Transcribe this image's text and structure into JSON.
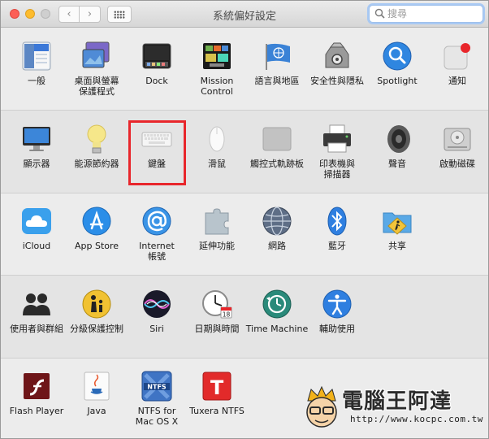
{
  "window": {
    "title": "系統偏好設定",
    "search_placeholder": "搜尋"
  },
  "rows": [
    [
      {
        "label": "一般",
        "icon": "general-icon"
      },
      {
        "label": "桌面與螢幕\n保護程式",
        "icon": "desktop-screensaver-icon"
      },
      {
        "label": "Dock",
        "icon": "dock-icon"
      },
      {
        "label": "Mission\nControl",
        "icon": "mission-control-icon"
      },
      {
        "label": "語言與地區",
        "icon": "language-region-icon"
      },
      {
        "label": "安全性與隱私",
        "icon": "security-privacy-icon"
      },
      {
        "label": "Spotlight",
        "icon": "spotlight-icon"
      },
      {
        "label": "通知",
        "icon": "notifications-icon"
      }
    ],
    [
      {
        "label": "顯示器",
        "icon": "displays-icon"
      },
      {
        "label": "能源節約器",
        "icon": "energy-saver-icon"
      },
      {
        "label": "鍵盤",
        "icon": "keyboard-icon"
      },
      {
        "label": "滑鼠",
        "icon": "mouse-icon"
      },
      {
        "label": "觸控式軌跡板",
        "icon": "trackpad-icon"
      },
      {
        "label": "印表機與\n掃描器",
        "icon": "printers-scanners-icon"
      },
      {
        "label": "聲音",
        "icon": "sound-icon"
      },
      {
        "label": "啟動磁碟",
        "icon": "startup-disk-icon"
      }
    ],
    [
      {
        "label": "iCloud",
        "icon": "icloud-icon"
      },
      {
        "label": "App Store",
        "icon": "app-store-icon"
      },
      {
        "label": "Internet\n帳號",
        "icon": "internet-accounts-icon"
      },
      {
        "label": "延伸功能",
        "icon": "extensions-icon"
      },
      {
        "label": "網路",
        "icon": "network-icon"
      },
      {
        "label": "藍牙",
        "icon": "bluetooth-icon"
      },
      {
        "label": "共享",
        "icon": "sharing-icon"
      }
    ],
    [
      {
        "label": "使用者與群組",
        "icon": "users-groups-icon"
      },
      {
        "label": "分級保護控制",
        "icon": "parental-controls-icon"
      },
      {
        "label": "Siri",
        "icon": "siri-icon"
      },
      {
        "label": "日期與時間",
        "icon": "date-time-icon"
      },
      {
        "label": "Time Machine",
        "icon": "time-machine-icon"
      },
      {
        "label": "輔助使用",
        "icon": "accessibility-icon"
      }
    ],
    [
      {
        "label": "Flash Player",
        "icon": "flash-player-icon"
      },
      {
        "label": "Java",
        "icon": "java-icon"
      },
      {
        "label": "NTFS for\nMac OS X",
        "icon": "ntfs-icon"
      },
      {
        "label": "Tuxera NTFS",
        "icon": "tuxera-icon"
      }
    ]
  ],
  "icon_text": {
    "general": "File\nNew\nOne",
    "calendar_day": "18",
    "ntfs": "NTFS",
    "tuxera": "T"
  },
  "highlight_color": "#e8262b",
  "watermark": {
    "text": "電腦王阿達",
    "url": "http://www.kocpc.com.tw"
  }
}
